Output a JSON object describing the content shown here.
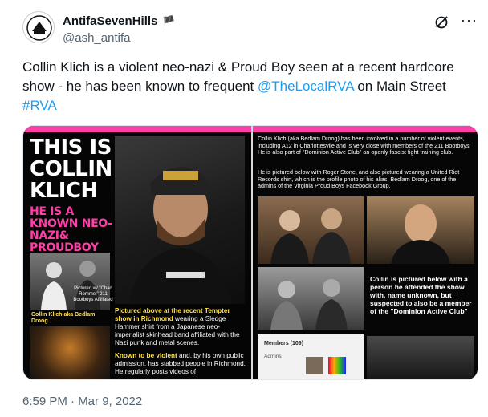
{
  "author": {
    "display_name": "AntifaSevenHills",
    "flag_icon": "black-flag-icon",
    "handle": "@ash_antifa"
  },
  "tweet": {
    "text_part1": "Collin Klich is a violent neo-nazi & Proud Boy seen at a recent hardcore show - he has been known to frequent ",
    "mention": "@TheLocalRVA",
    "text_part2": " on Main Street ",
    "hashtag": "#RVA"
  },
  "media": {
    "left": {
      "title": "THIS IS COLLIN KLICH",
      "subtitle": "HE IS A KNOWN NEO-NAZI& PROUDBOY",
      "mini_caption": "Pictured w/ \"Chad Rommel\" 211 Bootboys Affiliated",
      "yellow_label": "Collin Klich aka Bedlam Droog",
      "para1_bold": "Pictured above at the recent Tempter show in Richmond",
      "para1_rest": " wearing a Sledge Hammer shirt from a Japanese neo-imperialist skinhead band affiliated with the Nazi punk and metal scenes.",
      "para2_bold": "Known to be violent",
      "para2_rest": " and, by his own public admission, has stabbed people in Richmond. He regularly posts videos of"
    },
    "right": {
      "para1": "Collin Klich (aka Bedlam Droog) has been involved in a number of violent events, including A12 in Charlottesvile and is very close with members of the 211 Bootboys. He is also part of \"Dominion Active Club\" an openly fascist fight training club.",
      "para2": "He is pictured below with Roger Stone, and also pictured wearing a United Riot Records shirt, which is the profile photo of his alias, Bedlam Droog, one of the admins of the Virginia Proud Boys Facebook Group.",
      "caption": "Collin is pictured below with a person he attended the show with, name unknown, but suspected to also be a member of the \"Dominion Active Club\"",
      "members_title": "Members (109)",
      "members_admins": "Admins"
    }
  },
  "timestamp": "6:59 PM · Mar 9, 2022"
}
